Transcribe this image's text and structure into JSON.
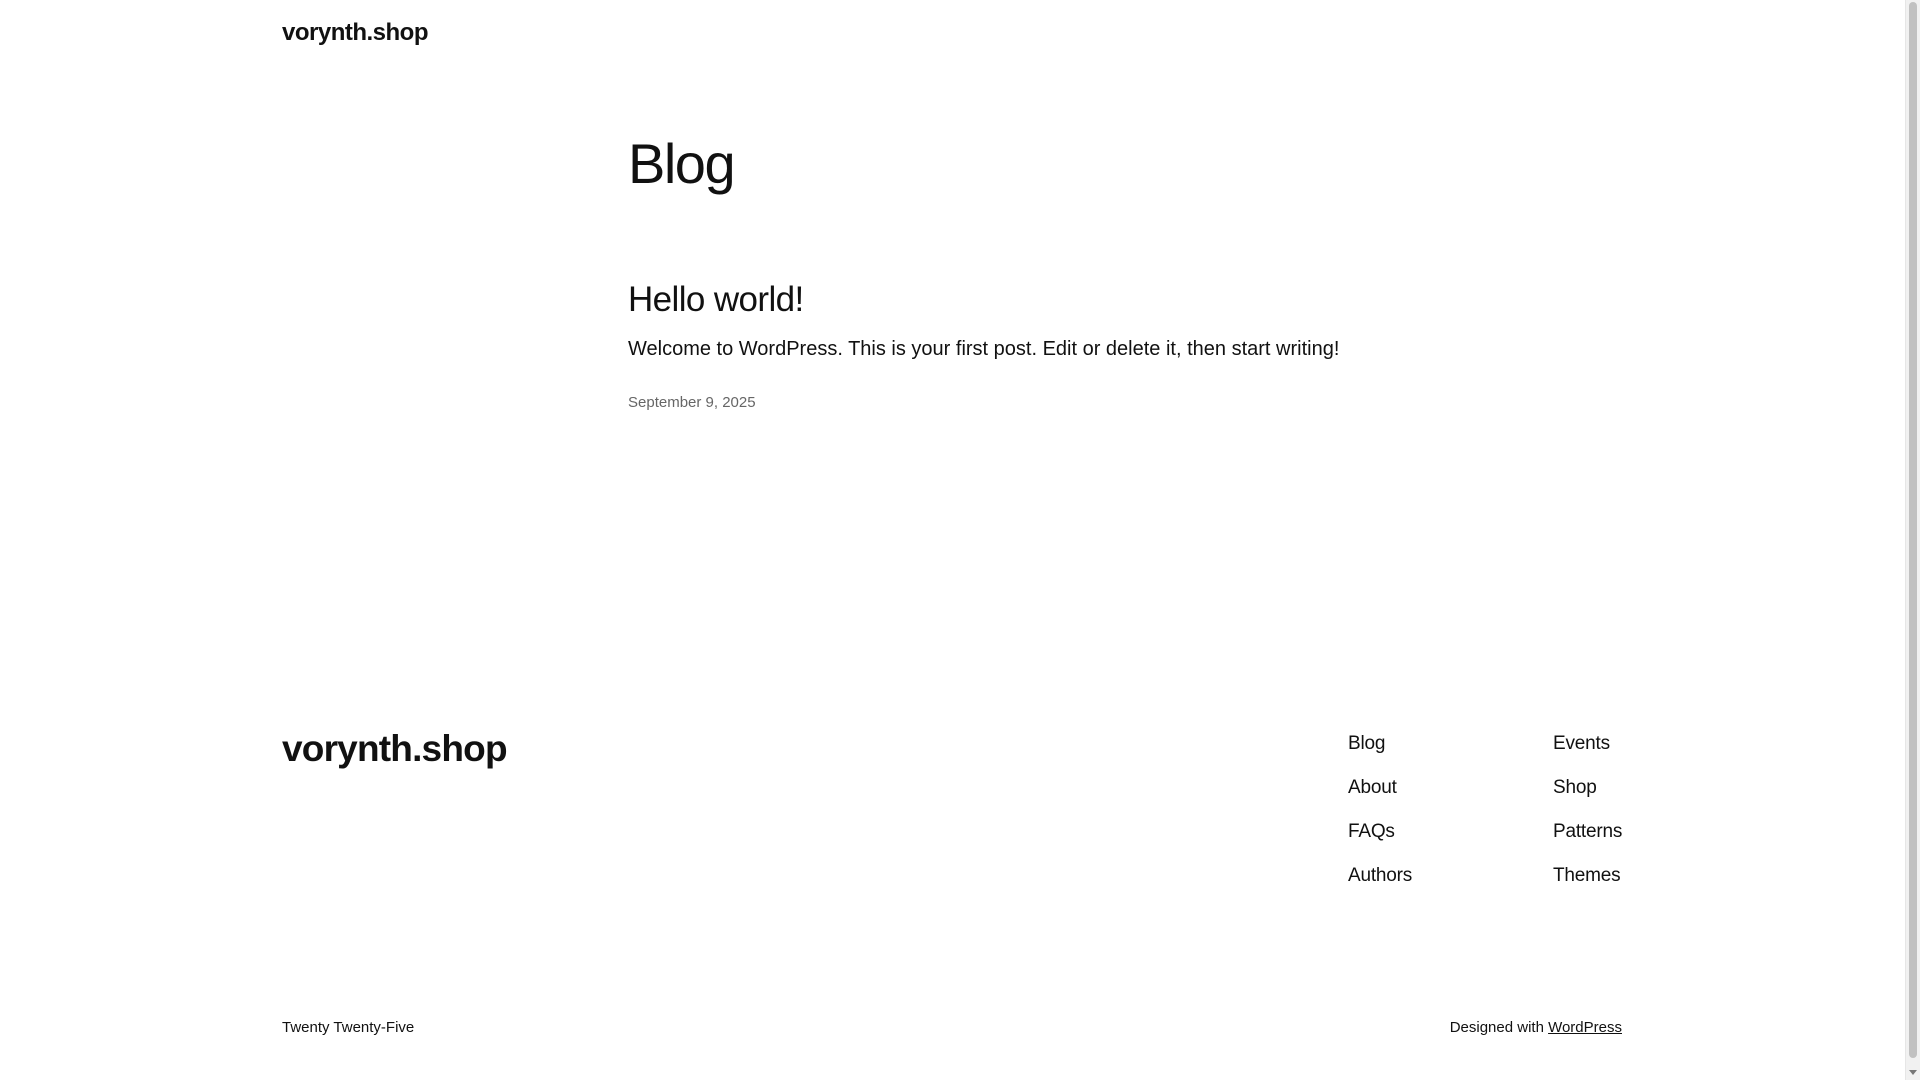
{
  "header": {
    "site_title": "vorynth.shop"
  },
  "main": {
    "heading": "Blog",
    "post": {
      "title": "Hello world!",
      "excerpt": "Welcome to WordPress. This is your first post. Edit or delete it, then start writing!",
      "date": "September 9, 2025"
    }
  },
  "footer": {
    "site_title": "vorynth.shop",
    "nav_col1": [
      "Blog",
      "About",
      "FAQs",
      "Authors"
    ],
    "nav_col2": [
      "Events",
      "Shop",
      "Patterns",
      "Themes"
    ],
    "credit_left": "Twenty Twenty-Five",
    "credit_right_prefix": "Designed with ",
    "credit_right_link": "WordPress"
  }
}
